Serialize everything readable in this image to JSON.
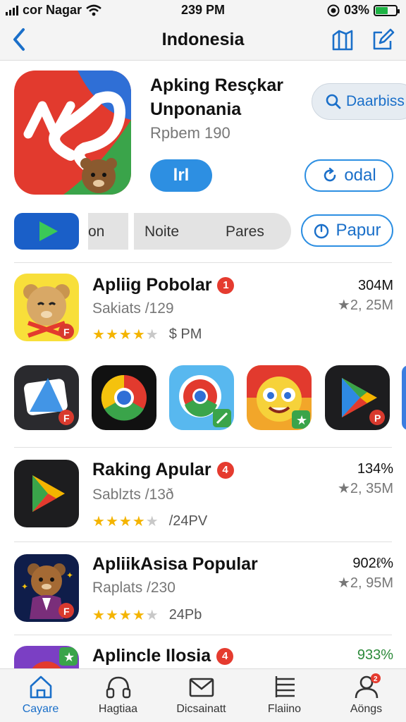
{
  "status_bar": {
    "carrier": "cor Nagar",
    "time": "239 PM",
    "battery": "03%"
  },
  "nav": {
    "title": "Indonesia",
    "back_icon": "chevron-left-icon",
    "actions": [
      "share-icon",
      "edit-icon"
    ]
  },
  "featured": {
    "title_line1": "Apking Resçkar",
    "title_line2": "Unponania",
    "subtitle": "Rpbem 190",
    "get_label": "lrl",
    "search_label": "Daarbiss",
    "reload_label": "odal"
  },
  "segments": {
    "items": [
      "on",
      "Noite",
      "Pares"
    ],
    "papur_label": "Papur"
  },
  "apps": [
    {
      "title": "Apliig Pobolar",
      "badge": "1",
      "subtitle": "Sakiats /129",
      "stars": 4,
      "note": "$ PM",
      "right1": "304M",
      "right2": "★2, 25M"
    },
    {
      "title": "Raking Apular",
      "badge": "4",
      "subtitle": "Sablzts /13ð",
      "stars": 4,
      "note": "/24PV",
      "right1": "134%",
      "right2": "★2, 35M"
    },
    {
      "title": "ApliikAsisa Popular",
      "badge": "",
      "subtitle": "Raplats /230",
      "stars": 4,
      "note": "24Pb",
      "right1": "902ℓ%",
      "right2": "★2, 95M"
    },
    {
      "title": "Aplincle Ilosia",
      "badge": "4",
      "subtitle": "",
      "stars": 0,
      "note": "",
      "right1": "933%",
      "right2": ""
    }
  ],
  "tabs": [
    {
      "label": "Cayare",
      "icon": "home-icon",
      "active": true
    },
    {
      "label": "Hagtiaa",
      "icon": "headphones-icon",
      "active": false
    },
    {
      "label": "Dicsainatt",
      "icon": "mail-icon",
      "active": false
    },
    {
      "label": "Flaiino",
      "icon": "list-icon",
      "active": false
    },
    {
      "label": "Aöngs",
      "icon": "profile-icon",
      "active": false,
      "badge": "2"
    }
  ],
  "colors": {
    "accent": "#2d8fe2",
    "badge": "#e53b2f",
    "star": "#f4b400"
  }
}
